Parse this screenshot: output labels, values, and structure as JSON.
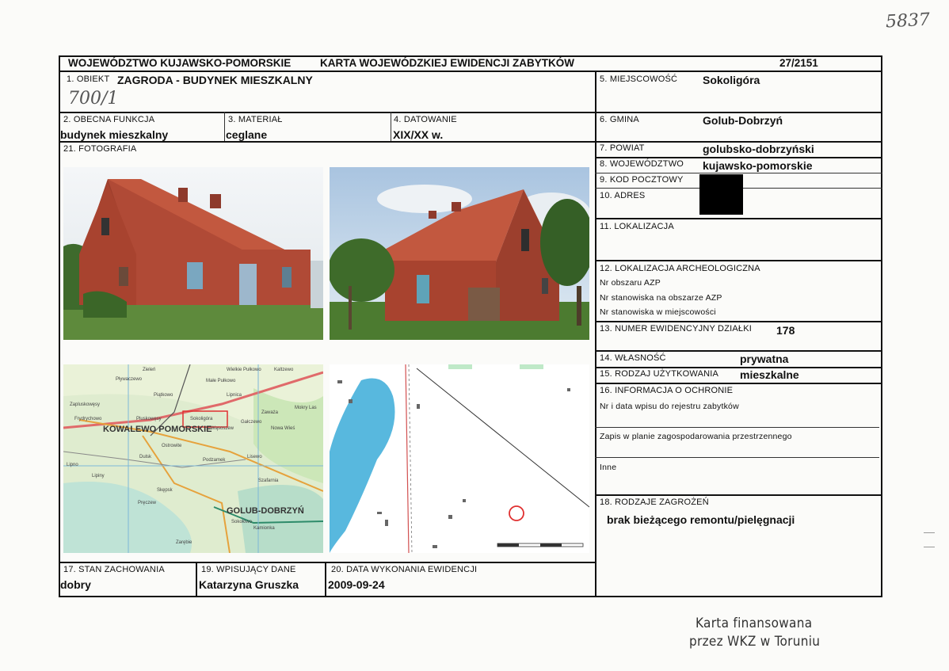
{
  "handwritten": {
    "top_number": "5837",
    "object_note": "700/1"
  },
  "header": {
    "voivodeship": "WOJEWÓDZTWO KUJAWSKO-POMORSKIE",
    "card_title": "KARTA WOJEWÓDZKIEJ EWIDENCJI ZABYTKÓW",
    "card_number": "27/2151"
  },
  "fields": {
    "obiekt_label": "1. OBIEKT",
    "obiekt_value": "ZAGRODA - BUDYNEK MIESZKALNY",
    "funkcja_label": "2. OBECNA FUNKCJA",
    "funkcja_value": "budynek mieszkalny",
    "material_label": "3. MATERIAŁ",
    "material_value": "ceglane",
    "datowanie_label": "4. DATOWANIE",
    "datowanie_value": "XIX/XX w.",
    "miejscowosc_label": "5. MIEJSCOWOŚĆ",
    "miejscowosc_value": "Sokoligóra",
    "gmina_label": "6. GMINA",
    "gmina_value": "Golub-Dobrzyń",
    "powiat_label": "7. POWIAT",
    "powiat_value": "golubsko-dobrzyński",
    "wojewodztwo_label": "8. WOJEWÓDZTWO",
    "wojewodztwo_value": "kujawsko-pomorskie",
    "kod_label": "9. KOD POCZTOWY",
    "adres_label": "10. ADRES",
    "lokalizacja_label": "11. LOKALIZACJA",
    "arch_label": "12. LOKALIZACJA ARCHEOLOGICZNA",
    "arch_line1": "Nr obszaru AZP",
    "arch_line2": "Nr stanowiska na obszarze AZP",
    "arch_line3": "Nr stanowiska w miejscowości",
    "dzialka_label": "13. NUMER EWIDENCYJNY DZIAŁKI",
    "dzialka_value": "178",
    "wlasnosc_label": "14. WŁASNOŚĆ",
    "wlasnosc_value": "prywatna",
    "uzytkowanie_label": "15. RODZAJ UŻYTKOWANIA",
    "uzytkowanie_value": "mieszkalne",
    "ochrona_label": "16. INFORMACJA O OCHRONIE",
    "ochrona_line1": "Nr i data wpisu do rejestru zabytków",
    "ochrona_line2": "Zapis w planie zagospodarowania przestrzennego",
    "ochrona_line3": "Inne",
    "zagrozenia_label": "18. RODZAJE ZAGROŻEŃ",
    "zagrozenia_value": "brak bieżącego remontu/pielęgnacji",
    "fotografia_label": "21. FOTOGRAFIA",
    "stan_label": "17. STAN ZACHOWANIA",
    "stan_value": "dobry",
    "wpisujacy_label": "19. WPISUJĄCY DANE",
    "wpisujacy_value": "Katarzyna Gruszka",
    "data_label": "20. DATA WYKONANIA EWIDENCJI",
    "data_value": "2009-09-24"
  },
  "map": {
    "town_main": "KOWALEWO POMORSKIE",
    "town_second": "GOLUB-DOBRZYŃ",
    "place_labels": [
      "Zieleń",
      "Wielkie Pułkowo",
      "Kaltzewo",
      "Pływaczewo",
      "Piątkowo",
      "Małe Pułkowo",
      "Lipnica",
      "Zapluskowęsy",
      "Frydrychowo",
      "Pluskowęsy",
      "Sokoligóra",
      "Wąsoszew",
      "Mokry Las",
      "Zaważa",
      "Gałczewo",
      "Nowa Wieś",
      "Podzamek",
      "Ostrowite",
      "Dulsk",
      "Skępsk",
      "Gołub-Dobrzyń",
      "Szafarnia",
      "Sokoligóra",
      "Kamionka",
      "Lisewo",
      "Sokołowo",
      "Lipno",
      "Lipiny",
      "Pręczew",
      "Zarębie"
    ]
  },
  "footer": {
    "line1": "Karta finansowana",
    "line2": "przez WKZ w Toruniu"
  },
  "colors": {
    "brick": "#a8432f",
    "roof": "#b8503a",
    "grass": "#4f7a34",
    "map_road": "#e06a6a",
    "water": "#58b8de"
  }
}
